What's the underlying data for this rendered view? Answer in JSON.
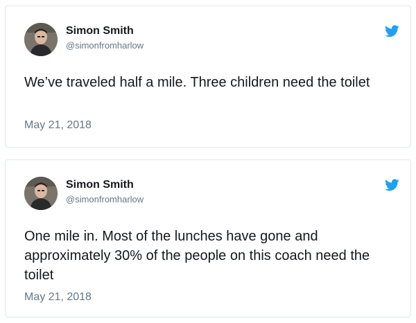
{
  "colors": {
    "bird": "#1da1f2",
    "name": "#14171a",
    "muted": "#657786",
    "border": "#e1e8ed"
  },
  "tweets": [
    {
      "name": "Simon Smith",
      "handle": "@simonfromharlow",
      "text": "We’ve traveled half a mile. Three children need the toilet",
      "date": "May 21, 2018",
      "icons": {
        "avatar": "profile-photo",
        "brand": "twitter-bird-icon"
      }
    },
    {
      "name": "Simon Smith",
      "handle": "@simonfromharlow",
      "text": "One mile in. Most of the lunches have gone and approximately 30% of the people on this coach need the toilet",
      "date": "May 21, 2018",
      "icons": {
        "avatar": "profile-photo",
        "brand": "twitter-bird-icon"
      }
    }
  ]
}
